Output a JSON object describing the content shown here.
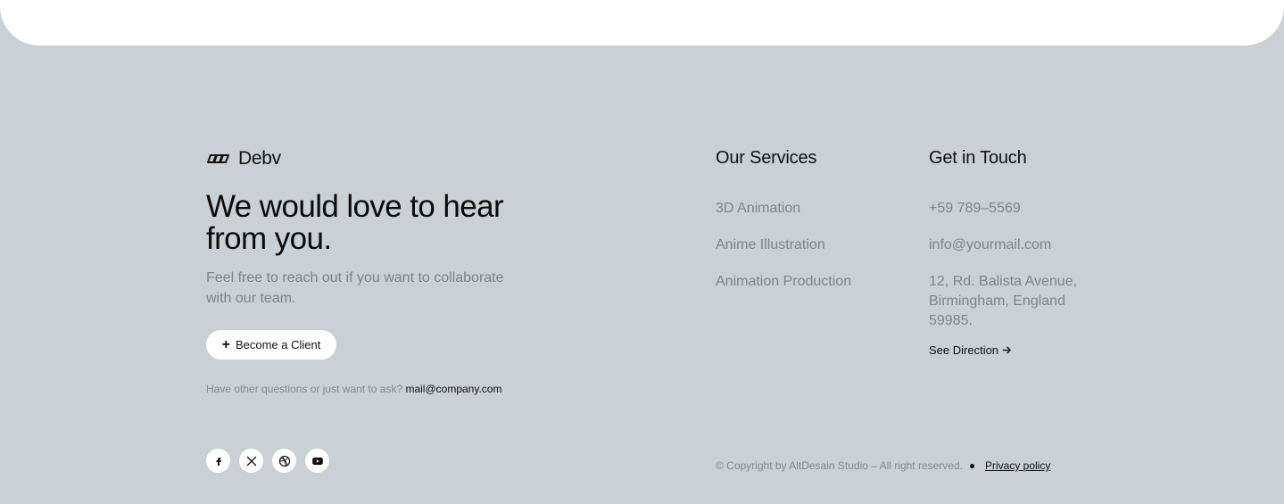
{
  "brand": {
    "name": "Debv"
  },
  "hero": {
    "headline": "We would love to hear from you.",
    "subtext": "Feel free to reach out if you want to collaborate with our team.",
    "cta_label": "Become a Client",
    "contact_prompt": "Have other questions or just want to ask?",
    "contact_email": "mail@company.com"
  },
  "socials": [
    {
      "icon": "facebook-icon"
    },
    {
      "icon": "x-icon"
    },
    {
      "icon": "dribbble-icon"
    },
    {
      "icon": "youtube-icon"
    }
  ],
  "services": {
    "title": "Our Services",
    "items": [
      "3D Animation",
      "Anime Illustration",
      "Animation Production"
    ]
  },
  "touch": {
    "title": "Get in Touch",
    "phone": "+59 789–5569",
    "email": "info@yourmail.com",
    "address": "12, Rd. Balista Avenue, Birmingham, England 59985.",
    "direction_label": "See Direction"
  },
  "footer": {
    "copyright": "© Copyright by AltDesain Studio – All right reserved.",
    "privacy_label": "Privacy policy"
  },
  "colors": {
    "background": "#c9d0d6",
    "card": "#ffffff",
    "text": "#0f0f0f",
    "muted": "#808488"
  }
}
